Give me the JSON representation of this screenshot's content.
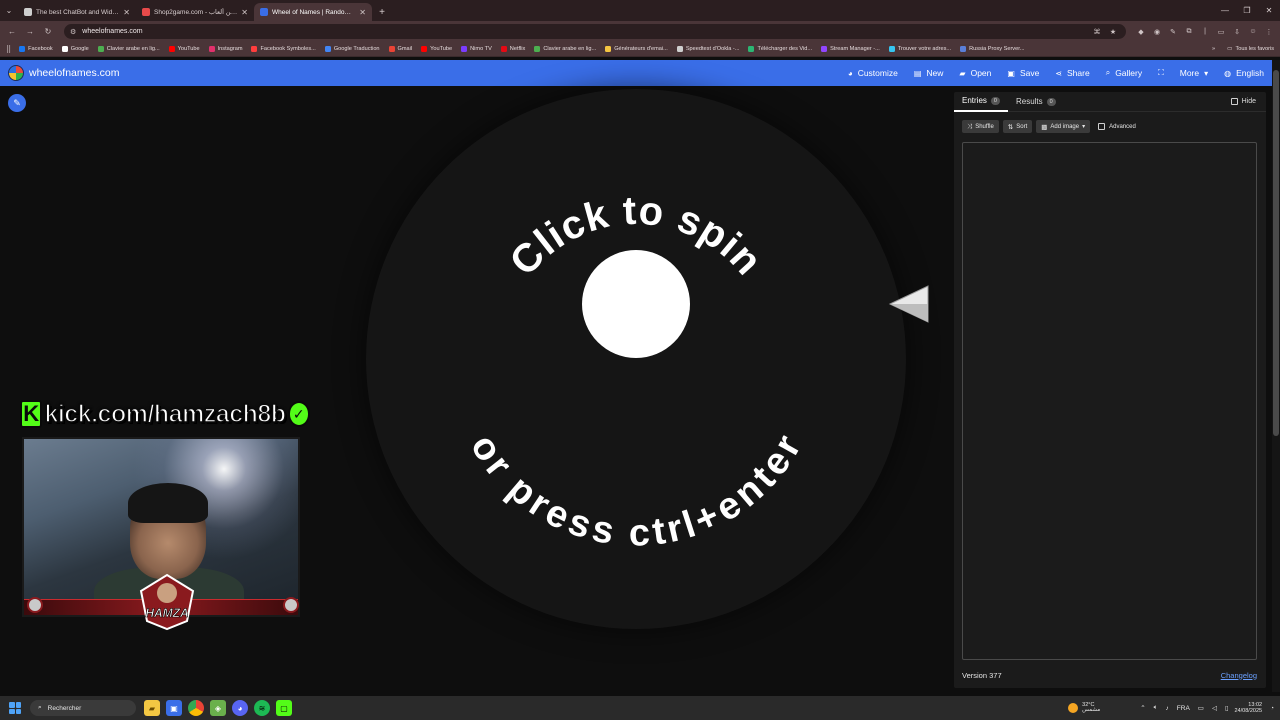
{
  "browser": {
    "tabs": [
      {
        "title": "The best ChatBot and Widgets",
        "favicon_color": "#cfcfcf",
        "active": false
      },
      {
        "title": "Shop2game.com - شحن ألعاب",
        "favicon_color": "#e84a4a",
        "active": false
      },
      {
        "title": "Wheel of Names | Random nam",
        "favicon_color": "#3a6ee8",
        "active": true
      }
    ],
    "url": "wheelofnames.com",
    "bookmarks": [
      {
        "label": "Facebook",
        "color": "#1877f2"
      },
      {
        "label": "Google",
        "color": "#ffffff"
      },
      {
        "label": "Clavier arabe en lig...",
        "color": "#4caf50"
      },
      {
        "label": "YouTube",
        "color": "#ff0000"
      },
      {
        "label": "Instagram",
        "color": "#e1306c"
      },
      {
        "label": "Facebook Symboles...",
        "color": "#ff3d3d"
      },
      {
        "label": "Google Traduction",
        "color": "#4285f4"
      },
      {
        "label": "Gmail",
        "color": "#ea4335"
      },
      {
        "label": "YouTube",
        "color": "#ff0000"
      },
      {
        "label": "Nimo TV",
        "color": "#7b3cff"
      },
      {
        "label": "Netflix",
        "color": "#e50914"
      },
      {
        "label": "Clavier arabe en lig...",
        "color": "#4caf50"
      },
      {
        "label": "Générateurs d'emai...",
        "color": "#f5c542"
      },
      {
        "label": "Speedtest d'Ookla -...",
        "color": "#cfcfcf"
      },
      {
        "label": "Télécharger des Vid...",
        "color": "#2bb673"
      },
      {
        "label": "Stream Manager -...",
        "color": "#9146ff"
      },
      {
        "label": "Trouver votre adres...",
        "color": "#36c5f0"
      },
      {
        "label": "Russia Proxy Server...",
        "color": "#5a7fd8"
      }
    ],
    "bookmarks_more": "»",
    "all_bookmarks": "Tous les favoris"
  },
  "app": {
    "site_name": "wheelofnames.com",
    "accent": "#3a6ee8",
    "menu": [
      {
        "label": "Customize",
        "icon": "palette-icon",
        "glyph": "◕"
      },
      {
        "label": "New",
        "icon": "document-icon",
        "glyph": "▤"
      },
      {
        "label": "Open",
        "icon": "folder-icon",
        "glyph": "▰"
      },
      {
        "label": "Save",
        "icon": "save-icon",
        "glyph": "▣"
      },
      {
        "label": "Share",
        "icon": "share-icon",
        "glyph": "⋖"
      },
      {
        "label": "Gallery",
        "icon": "search-icon",
        "glyph": "⌕"
      },
      {
        "label": "",
        "icon": "fullscreen-icon",
        "glyph": "⛶"
      },
      {
        "label": "More",
        "icon": "chevron-down-icon",
        "glyph": "▾"
      },
      {
        "label": "English",
        "icon": "globe-icon",
        "glyph": "◍"
      }
    ]
  },
  "wheel": {
    "top_text": "Click to spin",
    "bottom_text": "or press ctrl+enter"
  },
  "overlay": {
    "kick_handle": "kick.com/hamzach8b",
    "mascot_text": "HAMZA"
  },
  "panel": {
    "tabs": [
      {
        "label": "Entries",
        "count": "0",
        "active": true
      },
      {
        "label": "Results",
        "count": "0",
        "active": false
      }
    ],
    "hide_label": "Hide",
    "buttons": [
      {
        "label": "Shuffle",
        "icon": "shuffle-icon",
        "glyph": "⤨"
      },
      {
        "label": "Sort",
        "icon": "sort-icon",
        "glyph": "⇅"
      },
      {
        "label": "Add image",
        "icon": "image-icon",
        "glyph": "▩"
      }
    ],
    "advanced_label": "Advanced",
    "version": "Version 377",
    "changelog": "Changelog"
  },
  "taskbar": {
    "search_placeholder": "Rechercher",
    "weather_temp": "32°C",
    "weather_desc": "مشمس",
    "lang": "FRA",
    "time": "13:02",
    "date": "24/08/2025"
  }
}
